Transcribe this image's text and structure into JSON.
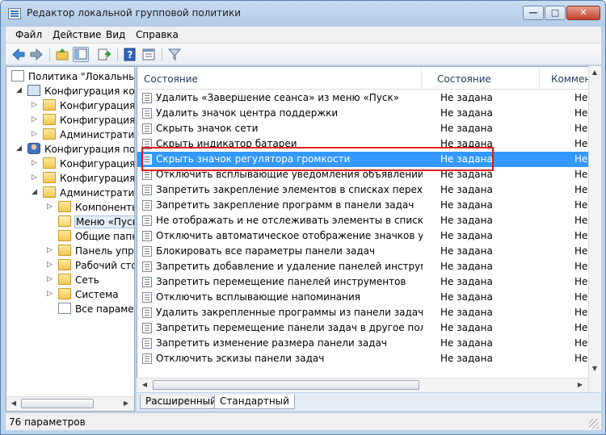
{
  "window": {
    "title": "Редактор локальной групповой политики",
    "buttons": {
      "minimize": "—",
      "maximize": "□",
      "close": "✕"
    }
  },
  "menu": [
    "Файл",
    "Действие",
    "Вид",
    "Справка"
  ],
  "toolbar": {
    "icons": [
      "back-icon",
      "forward-icon",
      "up-folder-icon",
      "show-hide-tree-icon",
      "export-list-icon",
      "help-icon",
      "properties-icon",
      "filter-icon"
    ]
  },
  "tree": {
    "items": [
      {
        "label": "Политика \"Локальный",
        "icon": "policy-icon",
        "expander": ""
      },
      {
        "label": "Конфигурация комп",
        "icon": "computer-icon",
        "expander": "◢"
      },
      {
        "label": "Конфигурация п",
        "icon": "folder-icon",
        "expander": "▷"
      },
      {
        "label": "Конфигурация V",
        "icon": "folder-icon",
        "expander": "▷"
      },
      {
        "label": "Административ",
        "icon": "folder-icon",
        "expander": "▷"
      },
      {
        "label": "Конфигурация поль",
        "icon": "user-icon",
        "expander": "◢"
      },
      {
        "label": "Конфигурация п",
        "icon": "folder-icon",
        "expander": "▷"
      },
      {
        "label": "Конфигурация V",
        "icon": "folder-icon",
        "expander": "▷"
      },
      {
        "label": "Административ",
        "icon": "folder-icon",
        "expander": "◢"
      },
      {
        "label": "Компоненты",
        "icon": "folder-icon",
        "expander": "▷"
      },
      {
        "label": "Меню «Пуск",
        "icon": "folder-open-icon",
        "expander": "",
        "selected": true
      },
      {
        "label": "Общие папк",
        "icon": "folder-icon",
        "expander": ""
      },
      {
        "label": "Панель упра",
        "icon": "folder-icon",
        "expander": "▷"
      },
      {
        "label": "Рабочий сто",
        "icon": "folder-icon",
        "expander": "▷"
      },
      {
        "label": "Сеть",
        "icon": "folder-icon",
        "expander": "▷"
      },
      {
        "label": "Система",
        "icon": "folder-icon",
        "expander": "▷"
      },
      {
        "label": "Все параметр",
        "icon": "settings-list-icon",
        "expander": ""
      }
    ]
  },
  "list": {
    "columns": [
      "Состояние",
      "Состояние",
      "Коммен"
    ],
    "rows": [
      {
        "name": "Удалить «Завершение сеанса» из меню «Пуск»",
        "state": "Не задана",
        "comment": "Не"
      },
      {
        "name": "Удалить значок центра поддержки",
        "state": "Не задана",
        "comment": "Не"
      },
      {
        "name": "Скрыть значок сети",
        "state": "Не задана",
        "comment": "Не"
      },
      {
        "name": "Скрыть индикатор батареи",
        "state": "Не задана",
        "comment": "Не"
      },
      {
        "name": "Скрыть значок регулятора громкости",
        "state": "Не задана",
        "comment": "Не",
        "selected": true
      },
      {
        "name": "Отключить всплывающие уведомления объявлений комп...",
        "state": "Не задана",
        "comment": "Не"
      },
      {
        "name": "Запретить закрепление элементов в списках переходов",
        "state": "Не задана",
        "comment": "Не"
      },
      {
        "name": "Запретить закрепление программ в панели задач",
        "state": "Не задана",
        "comment": "Не"
      },
      {
        "name": "Не отображать и не отслеживать элементы в списках пе...",
        "state": "Не задана",
        "comment": "Не"
      },
      {
        "name": "Отключить автоматическое отображение значков уведо...",
        "state": "Не задана",
        "comment": "Не"
      },
      {
        "name": "Блокировать все параметры панели задач",
        "state": "Не задана",
        "comment": "Не"
      },
      {
        "name": "Запретить добавление и удаление панелей инструментов",
        "state": "Не задана",
        "comment": "Не"
      },
      {
        "name": "Запретить перемещение панелей инструментов",
        "state": "Не задана",
        "comment": "Не"
      },
      {
        "name": "Отключить всплывающие напоминания",
        "state": "Не задана",
        "comment": "Не"
      },
      {
        "name": "Удалить закрепленные программы из панели задач",
        "state": "Не задана",
        "comment": "Не"
      },
      {
        "name": "Запретить перемещение панели задач в другое положен...",
        "state": "Не задана",
        "comment": "Не"
      },
      {
        "name": "Запретить изменение размера панели задач",
        "state": "Не задана",
        "comment": "Не"
      },
      {
        "name": "Отключить эскизы панели задач",
        "state": "Не задана",
        "comment": "Не"
      }
    ]
  },
  "tabs": [
    "Расширенный",
    "Стандартный"
  ],
  "status": "76 параметров",
  "colors": {
    "selection": "#3399ff",
    "highlight_box": "#e01919"
  }
}
